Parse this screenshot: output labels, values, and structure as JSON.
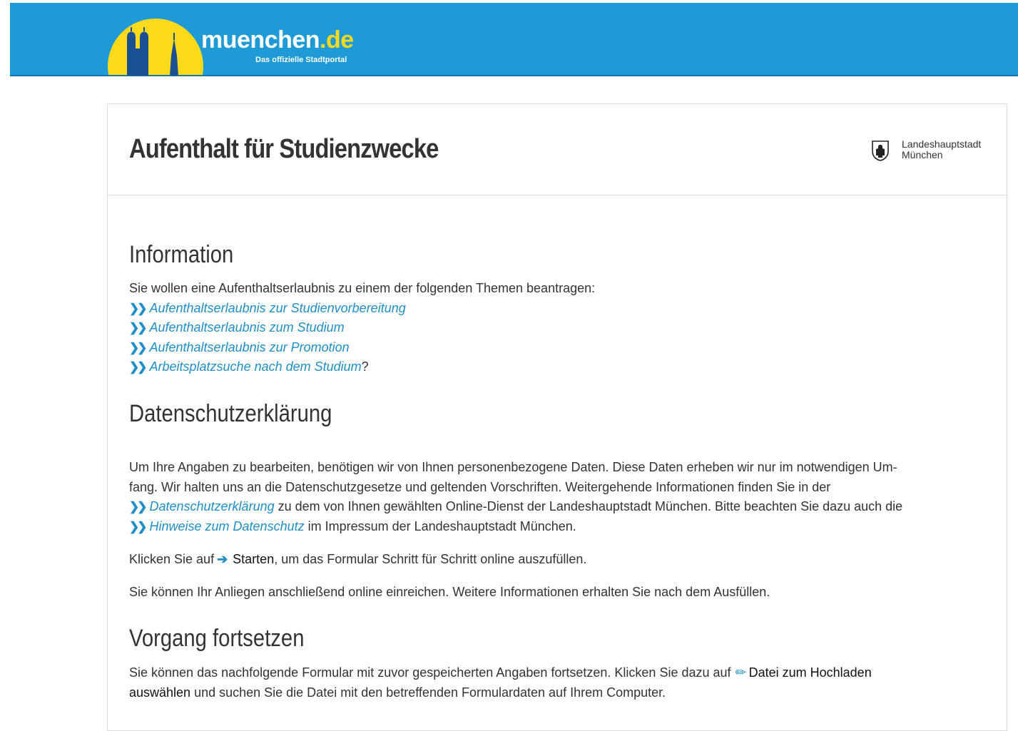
{
  "header": {
    "logo_text": "muenchen",
    "logo_tld": ".de",
    "logo_subtitle": "Das offizielle Stadtportal",
    "colors": {
      "bar": "#1e9bd7",
      "sun": "#fcd91b",
      "towers": "#1a4f94"
    }
  },
  "card": {
    "title": "Aufenthalt für Studienzwecke",
    "city_line1": "Landeshauptstadt",
    "city_line2": "München"
  },
  "information": {
    "heading": "Information",
    "intro": "Sie wollen eine Aufenthaltserlaubnis zu einem der folgenden Themen beantragen:",
    "links": [
      "Aufenthaltserlaubnis zur Studienvorbereitung",
      "Aufenthaltserlaubnis zum Studium",
      "Aufenthaltserlaubnis zur Promotion",
      "Arbeitsplatzsuche nach dem Studium"
    ],
    "trailing_question": "?"
  },
  "datenschutz": {
    "heading": "Datenschutzerklärung",
    "para_line1": "Um Ihre Angaben zu bearbeiten, benötigen wir von Ihnen personenbezogene Daten. Diese Daten erheben wir nur im notwendigen Um-",
    "para_line2": "fang. Wir halten uns an die Datenschutzgesetze und geltenden Vorschriften. Weitergehende Informationen finden Sie in der",
    "link1": "Datenschutzerklärung",
    "after_link1": " zu dem von Ihnen gewählten Online-Dienst der Landeshauptstadt München. Bitte beachten Sie dazu auch die",
    "link2": "Hinweise zum Datenschutz",
    "after_link2": " im Impressum der Landeshauptstadt München.",
    "start_before": "Klicken Sie auf",
    "start_label": "Starten",
    "start_after": ", um das Formular Schritt für Schritt online auszufüllen.",
    "submit_info": "Sie können Ihr Anliegen anschließend online einreichen. Weitere Informationen erhalten Sie nach dem Ausfüllen."
  },
  "vorgang": {
    "heading": "Vorgang fortsetzen",
    "text_before": "Sie können das nachfolgende Formular mit zuvor gespeicherten Angaben fortsetzen. Klicken Sie dazu auf",
    "upload_label_part1": "Datei zum Hochladen",
    "upload_label_part2": "auswählen",
    "text_after": " und suchen Sie die Datei mit den betreffenden Formulardaten auf Ihrem Computer."
  },
  "icons": {
    "link_chevron": "double-chevron-right-icon",
    "start_arrow": "arrow-right-icon",
    "upload": "paperclip-icon",
    "crest": "munich-crest-icon"
  }
}
